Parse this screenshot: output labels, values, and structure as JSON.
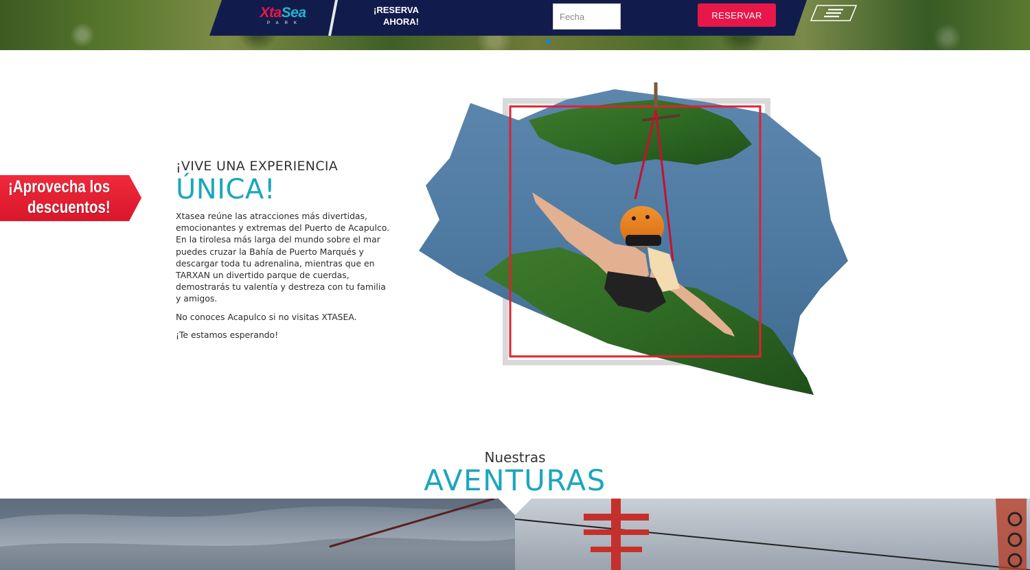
{
  "header": {
    "logo": {
      "primary_a": "Xta",
      "primary_b": "Sea",
      "secondary": "PARK"
    },
    "reserve_prompt_line1": "¡RESERVA",
    "reserve_prompt_line2": "AHORA!",
    "date_field": {
      "placeholder": "Fecha",
      "value": ""
    },
    "reserve_button": "RESERVAR",
    "menu_icon": "hamburger-menu-icon"
  },
  "hero_slider": {
    "active_slide": 1,
    "total_slides": 1
  },
  "promo_banner": {
    "line1": "¡Aprovecha los",
    "line2": "descuentos!"
  },
  "intro": {
    "kicker": "¡VIVE UNA EXPERIENCIA",
    "title": "ÚNICA!",
    "paragraphs": [
      "Xtasea reúne las atracciones más divertidas, emocionantes y extremas del Puerto de Acapulco. En la tirolesa más larga del mundo sobre el mar puedes cruzar la Bahía de Puerto Marqués y descargar toda tu adrenalina, mientras que en TARXAN un divertido parque de cuerdas, demostrarás tu valentía y destreza con tu familia y amigos.",
      "No conoces Acapulco si no visitas XTASEA.",
      "¡Te estamos esperando!"
    ]
  },
  "adventures": {
    "kicker": "Nuestras",
    "title": "AVENTURAS"
  },
  "colors": {
    "navy": "#121c4c",
    "accent_red": "#e8174a",
    "teal": "#1ba6bd",
    "promo_red": "#e2202f",
    "slider_dot": "#1e7fe0"
  }
}
